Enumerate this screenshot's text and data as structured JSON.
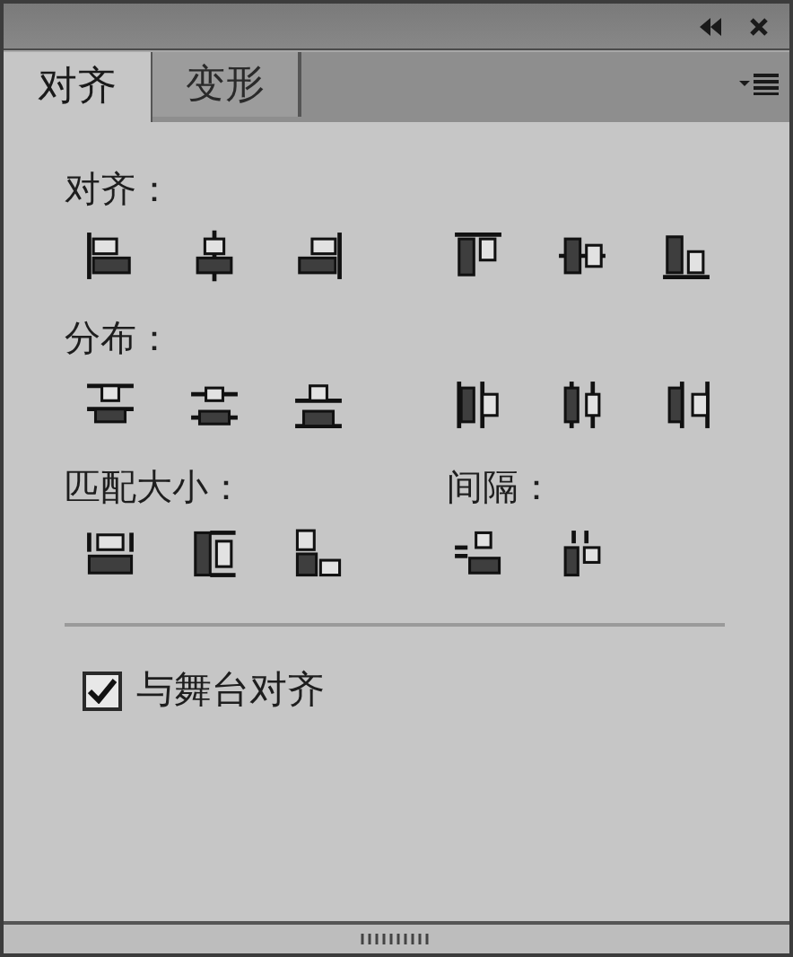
{
  "tabs": [
    {
      "label": "对齐",
      "selected": true
    },
    {
      "label": "变形",
      "selected": false
    }
  ],
  "rows": [
    {
      "groups": [
        {
          "label": "对齐：",
          "buttons": [
            {
              "kind": "align-left"
            },
            {
              "kind": "align-hcenter"
            },
            {
              "kind": "align-right"
            }
          ]
        },
        {
          "buttons": [
            {
              "kind": "align-top"
            },
            {
              "kind": "align-vcenter"
            },
            {
              "kind": "align-bottom"
            }
          ]
        }
      ]
    },
    {
      "groups": [
        {
          "label": "分布：",
          "buttons": [
            {
              "kind": "dist-top"
            },
            {
              "kind": "dist-vcenter"
            },
            {
              "kind": "dist-bottom"
            }
          ]
        },
        {
          "buttons": [
            {
              "kind": "dist-left"
            },
            {
              "kind": "dist-hcenter"
            },
            {
              "kind": "dist-right"
            }
          ]
        }
      ]
    },
    {
      "groups": [
        {
          "label": "匹配大小：",
          "buttons": [
            {
              "kind": "match-width"
            },
            {
              "kind": "match-height"
            },
            {
              "kind": "match-both"
            }
          ]
        },
        {
          "label": "间隔：",
          "buttons": [
            {
              "kind": "space-vertical"
            },
            {
              "kind": "space-horizontal"
            }
          ]
        }
      ]
    }
  ],
  "stage_align": {
    "label": "与舞台对齐",
    "checked": true
  }
}
